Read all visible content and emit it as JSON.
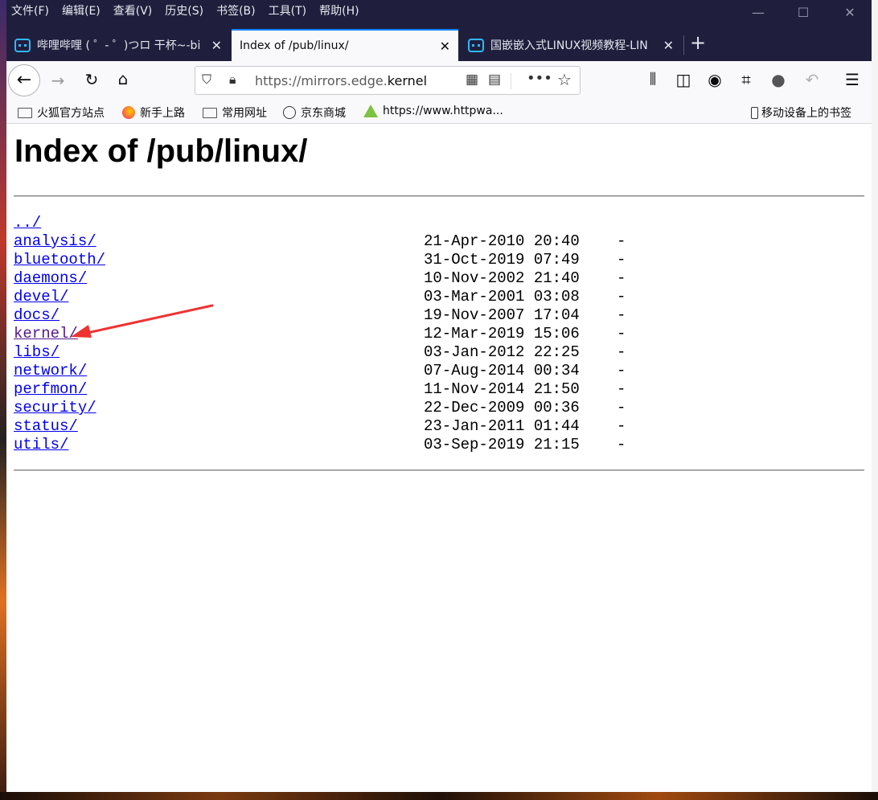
{
  "menu": [
    "文件(F)",
    "编辑(E)",
    "查看(V)",
    "历史(S)",
    "书签(B)",
    "工具(T)",
    "帮助(H)"
  ],
  "window_controls": {
    "minimize": "—",
    "maximize": "☐",
    "close": "✕"
  },
  "tabs": [
    {
      "title": "哔哩哔哩 ( ゜- ゜)つロ 干杯~-bi",
      "active": false,
      "close": "✕"
    },
    {
      "title": "Index of /pub/linux/",
      "active": true,
      "close": "✕"
    },
    {
      "title": "国嵌嵌入式LINUX视频教程-LIN",
      "active": false,
      "close": "✕"
    }
  ],
  "new_tab": "+",
  "url": {
    "prefix": "https://mirrors.edge.",
    "highlight": "kernel"
  },
  "bookmarks": [
    "火狐官方站点",
    "新手上路",
    "常用网址",
    "京东商城",
    "https://www.httpwa...",
    "移动设备上的书签"
  ],
  "page": {
    "title": "Index of /pub/linux/",
    "parent_link": "../",
    "entries": [
      {
        "name": "analysis/",
        "date": "21-Apr-2010 20:40",
        "size": "-"
      },
      {
        "name": "bluetooth/",
        "date": "31-Oct-2019 07:49",
        "size": "-"
      },
      {
        "name": "daemons/",
        "date": "10-Nov-2002 21:40",
        "size": "-"
      },
      {
        "name": "devel/",
        "date": "03-Mar-2001 03:08",
        "size": "-"
      },
      {
        "name": "docs/",
        "date": "19-Nov-2007 17:04",
        "size": "-"
      },
      {
        "name": "kernel/",
        "date": "12-Mar-2019 15:06",
        "size": "-"
      },
      {
        "name": "libs/",
        "date": "03-Jan-2012 22:25",
        "size": "-"
      },
      {
        "name": "network/",
        "date": "07-Aug-2014 00:34",
        "size": "-"
      },
      {
        "name": "perfmon/",
        "date": "11-Nov-2014 21:50",
        "size": "-"
      },
      {
        "name": "security/",
        "date": "22-Dec-2009 00:36",
        "size": "-"
      },
      {
        "name": "status/",
        "date": "23-Jan-2011 01:44",
        "size": "-"
      },
      {
        "name": "utils/",
        "date": "03-Sep-2019 21:15",
        "size": "-"
      }
    ]
  },
  "colors": {
    "link": "#0000ee",
    "visited": "#551a8b",
    "annotation_arrow": "#ee3333",
    "tab_accent": "#0a84ff"
  },
  "icons": [
    "back-arrow-icon",
    "forward-arrow-icon",
    "reload-icon",
    "home-icon",
    "tracking-shield-icon",
    "lock-icon",
    "qr-code-icon",
    "reader-view-icon",
    "page-actions-icon",
    "bookmark-star-icon",
    "library-icon",
    "sidebar-icon",
    "account-icon",
    "screenshot-icon",
    "chat-icon",
    "undo-icon",
    "hamburger-menu-icon"
  ]
}
